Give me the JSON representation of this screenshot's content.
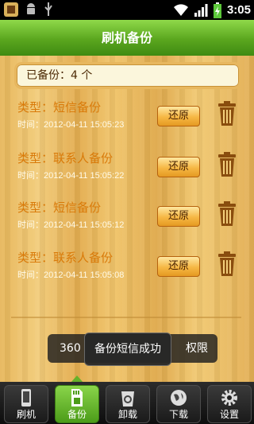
{
  "statusbar": {
    "time": "3:05",
    "icons": [
      "app-notification-icon",
      "android-debug-icon",
      "usb-icon",
      "wifi-icon",
      "signal-icon",
      "battery-charging-icon"
    ]
  },
  "header": {
    "title": "刷机备份"
  },
  "summary": {
    "label": "已备份：4 个"
  },
  "backups": [
    {
      "type": "类型：短信备份",
      "time": "时间：2012-04-11 15:05:23",
      "restore_label": "还原"
    },
    {
      "type": "类型：联系人备份",
      "time": "时间：2012-04-11 15:05:22",
      "restore_label": "还原"
    },
    {
      "type": "类型：短信备份",
      "time": "时间：2012-04-11 15:05:12",
      "restore_label": "还原"
    },
    {
      "type": "类型：联系人备份",
      "time": "时间：2012-04-11 15:05:08",
      "restore_label": "还原"
    }
  ],
  "toast": {
    "message": "备份短信成功",
    "underlying_left": "360",
    "underlying_right": "权限"
  },
  "tabs": [
    {
      "label": "刷机",
      "icon": "phone-icon",
      "active": false
    },
    {
      "label": "备份",
      "icon": "sd-card-icon",
      "active": true
    },
    {
      "label": "卸载",
      "icon": "recycle-bin-icon",
      "active": false
    },
    {
      "label": "下载",
      "icon": "globe-download-icon",
      "active": false
    },
    {
      "label": "设置",
      "icon": "gear-icon",
      "active": false
    }
  ],
  "colors": {
    "title_bar": "#5aa61e",
    "item_type_text": "#d97a09",
    "restore_button": "#f6b744",
    "wood": "#e7b65a"
  }
}
